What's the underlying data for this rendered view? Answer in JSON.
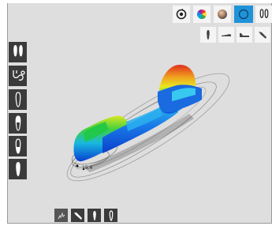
{
  "app": {
    "measure_label": "15.4"
  },
  "top_toolbar": {
    "tools": [
      {
        "name": "reset-view",
        "icon": "reset-icon",
        "active": false
      },
      {
        "name": "color-map",
        "icon": "color-wheel-icon",
        "active": false
      },
      {
        "name": "texture",
        "icon": "texture-sphere-icon",
        "active": false
      },
      {
        "name": "outline",
        "icon": "circle-outline-icon",
        "active": true
      },
      {
        "name": "pair-feet",
        "icon": "footprints-icon",
        "active": false
      }
    ]
  },
  "view_toolbar": {
    "views": [
      {
        "name": "view-sole-top",
        "icon": "sole-top-icon"
      },
      {
        "name": "view-side",
        "icon": "sole-side-icon"
      },
      {
        "name": "view-medial",
        "icon": "sole-medial-icon"
      },
      {
        "name": "view-angle",
        "icon": "sole-angle-icon"
      }
    ]
  },
  "left_toolbar": {
    "tools": [
      {
        "name": "two-feet",
        "icon": "footprints-icon"
      },
      {
        "name": "stethoscope",
        "icon": "stethoscope-icon"
      },
      {
        "name": "foot-outline",
        "icon": "foot-outline-icon"
      },
      {
        "name": "foot-segment",
        "icon": "foot-segment-icon"
      },
      {
        "name": "heel-half",
        "icon": "heel-half-icon"
      },
      {
        "name": "full-foot",
        "icon": "full-foot-icon"
      }
    ]
  },
  "bottom_toolbar": {
    "tools": [
      {
        "name": "pressure",
        "icon": "pressure-icon"
      },
      {
        "name": "insole",
        "icon": "insole-icon"
      },
      {
        "name": "foot-front",
        "icon": "foot-front-icon"
      },
      {
        "name": "foot-single",
        "icon": "foot-single-icon"
      }
    ]
  },
  "colors": {
    "accent": "#1f93d8",
    "panel": "#3b3b3b",
    "viewport_bg": "#dedede"
  }
}
